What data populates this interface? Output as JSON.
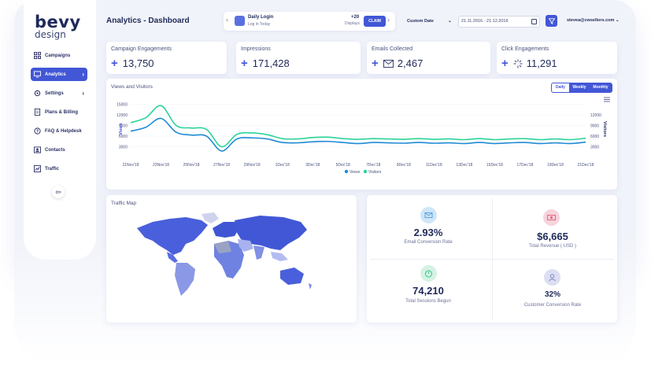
{
  "brand": {
    "name": "bevy",
    "sub": "design"
  },
  "sidebar": {
    "items": [
      {
        "label": "Campaigns"
      },
      {
        "label": "Analytics"
      },
      {
        "label": "Settings"
      },
      {
        "label": "Plans & Billing"
      },
      {
        "label": "FAQ & Helpdesk"
      },
      {
        "label": "Contacts"
      },
      {
        "label": "Traffic"
      }
    ],
    "collapse": "⇦"
  },
  "header": {
    "title": "Analytics - Dashboard",
    "daily_login": {
      "title": "Daily Login",
      "subtitle": "Log in Today",
      "points": "+20",
      "points_label": "Displays",
      "claim": "CLAIM"
    },
    "date_select": "Custom Date",
    "date_range": "21.11.2016 - 21.12.2016",
    "user_email": "stevea@cwsellors.com"
  },
  "stats": [
    {
      "label": "Campaign Engagements",
      "value": "13,750",
      "icon": "plus-icon"
    },
    {
      "label": "Impressions",
      "value": "171,428",
      "icon": "plus-icon"
    },
    {
      "label": "Emails Collected",
      "value": "2,467",
      "icon": "envelope-icon"
    },
    {
      "label": "Click Engagements",
      "value": "11,291",
      "icon": "sparkle-icon"
    }
  ],
  "chart_panel": {
    "title": "Views and Visitors",
    "toggles": [
      "Daily",
      "Weekly",
      "Monthly"
    ],
    "active_toggle": "Weekly"
  },
  "chart_data": {
    "type": "line",
    "title": "Views and Visitors",
    "ylabel": "Views",
    "y2label": "Visitors",
    "yticks": [
      3000,
      6000,
      9000,
      12000,
      15000
    ],
    "y2ticks": [
      3000,
      6000,
      9000,
      12000
    ],
    "ylim": [
      0,
      16000
    ],
    "xtick_labels": [
      "21Nov'18",
      "23Nov'18",
      "25Nov'18",
      "27Nov'18",
      "29Nov'18",
      "1Dec'18",
      "3Dec'18",
      "5Dec'18",
      "7Dec'18",
      "9Dec'18",
      "11Dec'18",
      "13Dec'18",
      "15Dec'18",
      "17Dec'18",
      "19Dec'18",
      "21Dec'18"
    ],
    "x": [
      0,
      0.5,
      1,
      1.5,
      2,
      2.5,
      3,
      3.5,
      4,
      4.5,
      5,
      5.5,
      6,
      6.5,
      7,
      7.5,
      8,
      8.5,
      9,
      9.5,
      10,
      10.5,
      11,
      11.5,
      12,
      12.5,
      13,
      13.5,
      14,
      14.5,
      15
    ],
    "series": [
      {
        "name": "Views",
        "color": "#1f8bd6",
        "values": [
          7400,
          8500,
          11000,
          7100,
          6300,
          6000,
          1800,
          5200,
          5500,
          5200,
          4200,
          4100,
          4400,
          4500,
          4200,
          3900,
          4200,
          4100,
          4000,
          4200,
          4000,
          4100,
          3900,
          4200,
          3900,
          4100,
          4200,
          3900,
          4100,
          3900,
          4300
        ]
      },
      {
        "name": "Visitors",
        "color": "#2bd49a",
        "values": [
          9800,
          11200,
          14600,
          9000,
          8300,
          7900,
          3000,
          6500,
          6900,
          6400,
          5300,
          5200,
          5600,
          5700,
          5300,
          5100,
          5300,
          5200,
          5100,
          5300,
          5100,
          5200,
          5000,
          5300,
          5000,
          5200,
          5300,
          5000,
          5200,
          5000,
          5400
        ]
      }
    ],
    "legend": [
      "Views",
      "Visitors"
    ],
    "legend_position": "bottom-center"
  },
  "traffic_map": {
    "title": "Traffic Map"
  },
  "kpis": [
    {
      "value": "2.93%",
      "label": "Email Conversion Rate",
      "icon": "envelope-icon",
      "color": "#cfe6f7"
    },
    {
      "value": "$6,665",
      "label": "Total Revenue ( USD )",
      "icon": "money-icon",
      "color": "#f7d3dc"
    },
    {
      "value": "74,210",
      "label": "Total Sessions Begun",
      "icon": "timer-icon",
      "color": "#d4f2e4"
    },
    {
      "value": "32%",
      "label": "Customer Conversion Rate",
      "icon": "user-icon",
      "color": "#dcdff2"
    }
  ]
}
